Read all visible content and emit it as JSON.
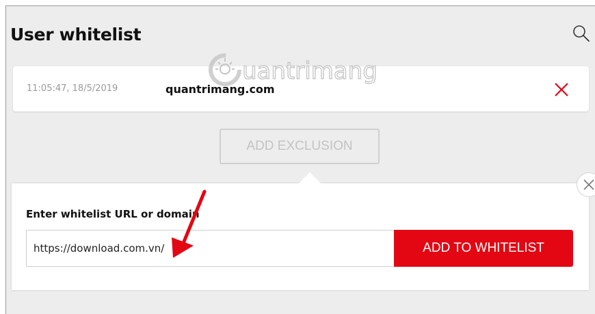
{
  "page": {
    "title": "User whitelist"
  },
  "watermark": {
    "text": "uantrimang"
  },
  "whitelist_entries": [
    {
      "time": "11:05:47, 18/5/2019",
      "domain": "quantrimang.com"
    }
  ],
  "add_exclusion_label": "ADD EXCLUSION",
  "popup": {
    "label": "Enter whitelist URL or domain",
    "input_value": "https://download.com.vn/",
    "button_label": "ADD TO WHITELIST"
  },
  "icons": {
    "search": "search-icon",
    "remove": "close-icon",
    "popup_close": "close-icon",
    "arrow": "arrow-icon"
  },
  "colors": {
    "accent": "#e30613",
    "background": "#ededed"
  }
}
